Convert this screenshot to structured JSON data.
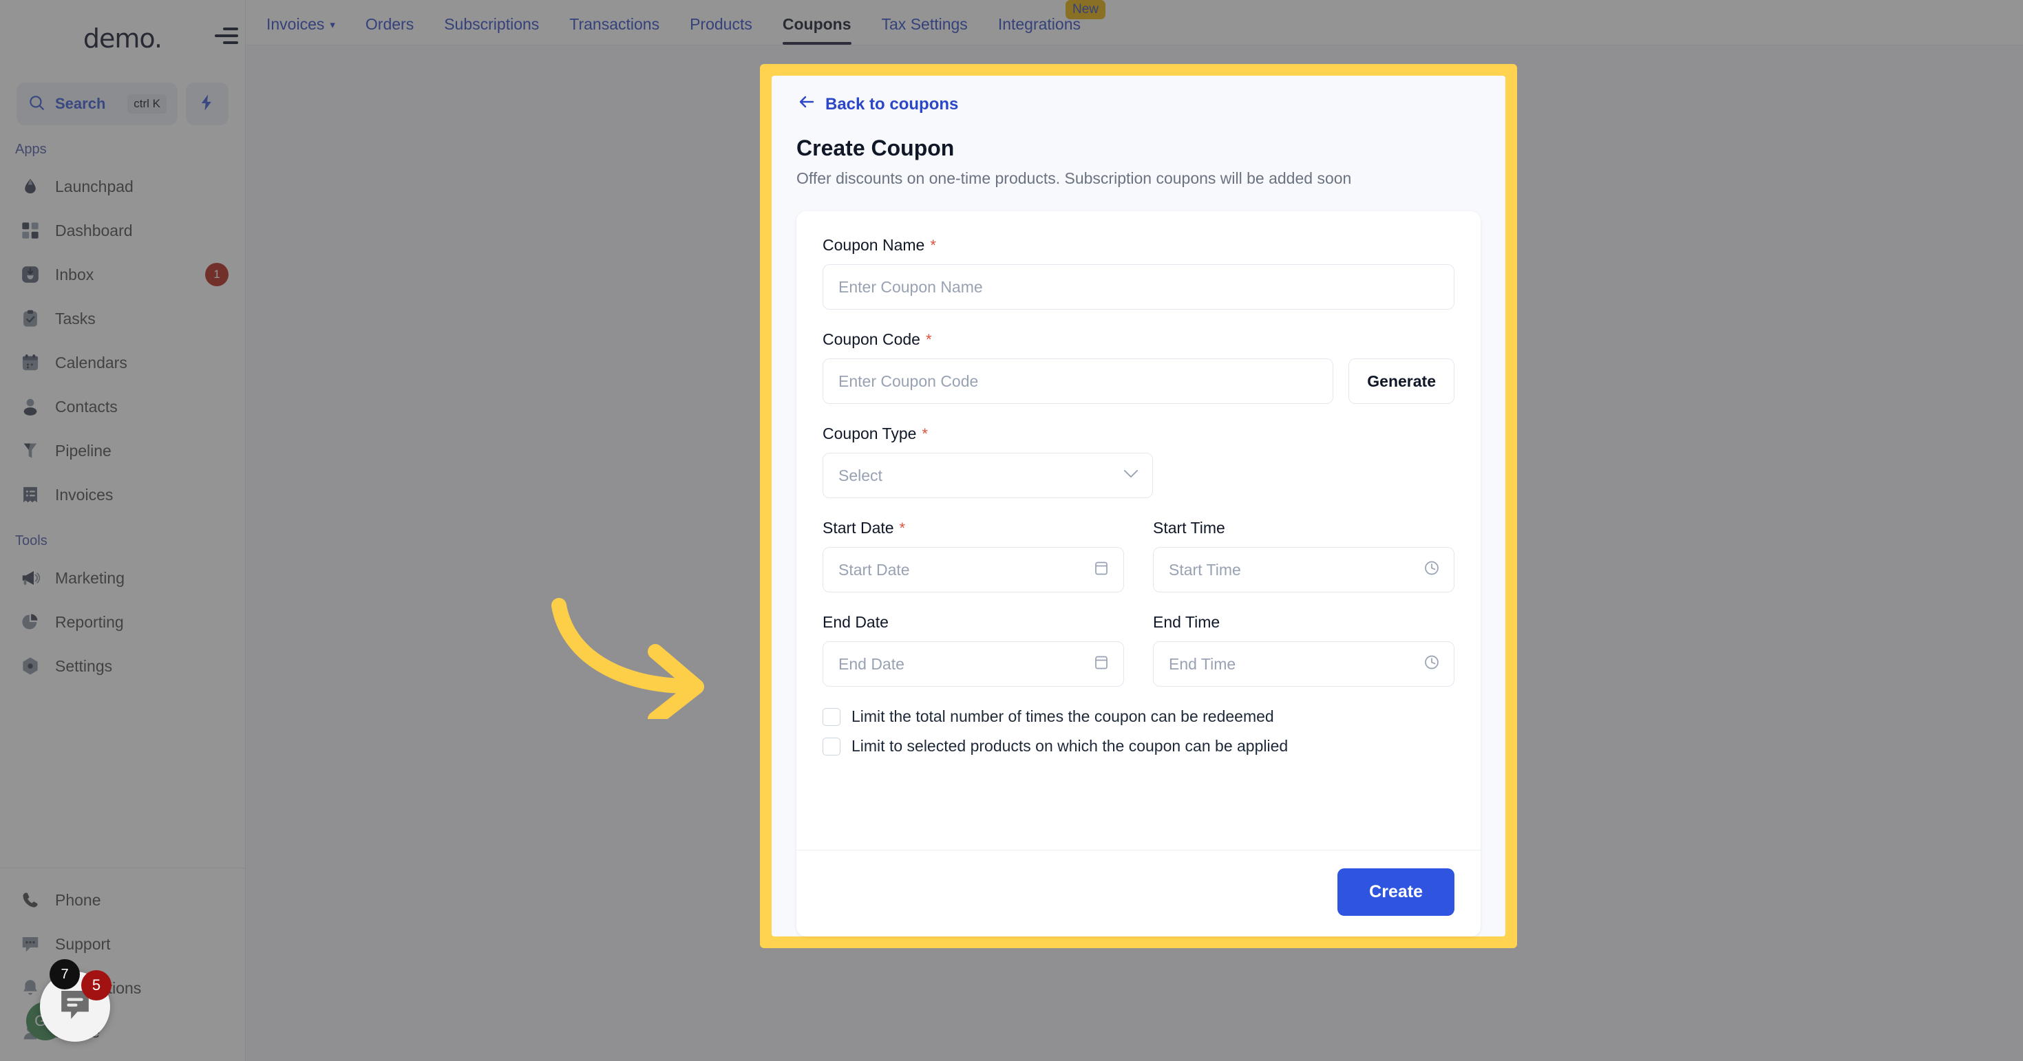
{
  "sidebar": {
    "brand": "demo",
    "search": {
      "label": "Search",
      "shortcut": "ctrl K",
      "icon": "search-icon"
    },
    "quick_action_icon": "bolt-icon",
    "sections": [
      {
        "title": "Apps",
        "items": [
          {
            "label": "Launchpad",
            "icon": "launchpad-icon",
            "badge": ""
          },
          {
            "label": "Dashboard",
            "icon": "dashboard-icon",
            "badge": ""
          },
          {
            "label": "Inbox",
            "icon": "inbox-icon",
            "badge": "1"
          },
          {
            "label": "Tasks",
            "icon": "tasks-icon",
            "badge": ""
          },
          {
            "label": "Calendars",
            "icon": "calendar-icon",
            "badge": ""
          },
          {
            "label": "Contacts",
            "icon": "contacts-icon",
            "badge": ""
          },
          {
            "label": "Pipeline",
            "icon": "pipeline-icon",
            "badge": ""
          },
          {
            "label": "Invoices",
            "icon": "invoices-icon",
            "badge": ""
          }
        ]
      },
      {
        "title": "Tools",
        "items": [
          {
            "label": "Marketing",
            "icon": "megaphone-icon",
            "badge": ""
          },
          {
            "label": "Reporting",
            "icon": "piechart-icon",
            "badge": ""
          },
          {
            "label": "Settings",
            "icon": "gear-icon",
            "badge": ""
          }
        ]
      }
    ],
    "bottom_items": [
      {
        "label": "Phone",
        "icon": "phone-icon"
      },
      {
        "label": "Support",
        "icon": "support-chat-icon"
      },
      {
        "label": "Notifications",
        "icon": "bell-icon"
      },
      {
        "label": "Profile",
        "icon": "profile-icon"
      }
    ],
    "avatar_initials": "GP",
    "chat_widget": {
      "icon": "chat-bubble-icon",
      "badge_dark": "7",
      "badge_red": "5"
    }
  },
  "topnav": {
    "tabs": [
      {
        "label": "Invoices",
        "has_caret": true,
        "active": false,
        "badge": ""
      },
      {
        "label": "Orders",
        "has_caret": false,
        "active": false,
        "badge": ""
      },
      {
        "label": "Subscriptions",
        "has_caret": false,
        "active": false,
        "badge": ""
      },
      {
        "label": "Transactions",
        "has_caret": false,
        "active": false,
        "badge": ""
      },
      {
        "label": "Products",
        "has_caret": false,
        "active": false,
        "badge": ""
      },
      {
        "label": "Coupons",
        "has_caret": false,
        "active": true,
        "badge": ""
      },
      {
        "label": "Tax Settings",
        "has_caret": false,
        "active": false,
        "badge": ""
      },
      {
        "label": "Integrations",
        "has_caret": false,
        "active": false,
        "badge": "New"
      }
    ]
  },
  "modal": {
    "back_link": "Back to coupons",
    "title": "Create Coupon",
    "subtitle": "Offer discounts on one-time products. Subscription coupons will be added soon",
    "fields": {
      "coupon_name": {
        "label": "Coupon Name",
        "required": true,
        "placeholder": "Enter Coupon Name",
        "value": ""
      },
      "coupon_code": {
        "label": "Coupon Code",
        "required": true,
        "placeholder": "Enter Coupon Code",
        "value": "",
        "button": "Generate"
      },
      "coupon_type": {
        "label": "Coupon Type",
        "required": true,
        "placeholder": "Select",
        "value": ""
      },
      "start_date": {
        "label": "Start Date",
        "required": true,
        "placeholder": "Start Date",
        "value": "",
        "icon": "calendar-icon"
      },
      "start_time": {
        "label": "Start Time",
        "required": false,
        "placeholder": "Start Time",
        "value": "",
        "icon": "clock-icon"
      },
      "end_date": {
        "label": "End Date",
        "required": false,
        "placeholder": "End Date",
        "value": "",
        "icon": "calendar-icon"
      },
      "end_time": {
        "label": "End Time",
        "required": false,
        "placeholder": "End Time",
        "value": "",
        "icon": "clock-icon"
      }
    },
    "checkboxes": [
      {
        "label": "Limit the total number of times the coupon can be redeemed",
        "checked": false
      },
      {
        "label": "Limit to selected products on which the coupon can be applied",
        "checked": false
      }
    ],
    "submit_label": "Create"
  },
  "annotation": {
    "type": "curved-arrow",
    "color": "#fdcf48",
    "points_to": "create-coupon-modal"
  },
  "colors": {
    "accent_blue": "#2f55e0",
    "link_blue": "#2b47c7",
    "highlight_yellow": "#ffd34f",
    "required_red": "#e0533d",
    "badge_red": "#b42318",
    "new_badge": "#e8b007",
    "avatar_green": "#3d8b52",
    "modal_bg": "#f7f9fc"
  }
}
